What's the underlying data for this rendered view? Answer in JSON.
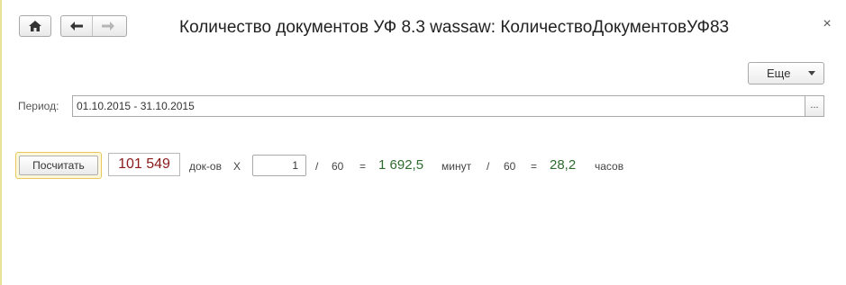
{
  "window": {
    "title": "Количество документов УФ 8.3 wassaw: КоличествоДокументовУФ83",
    "close_glyph": "×"
  },
  "nav": {
    "home_icon": "home-icon",
    "back_icon": "arrow-left-icon",
    "forward_icon": "arrow-right-icon"
  },
  "toolbar": {
    "more_label": "Еще"
  },
  "period": {
    "label": "Период:",
    "value": "01.10.2015 - 31.10.2015",
    "select_label": "..."
  },
  "calc": {
    "button_label": "Посчитать",
    "doc_count": "101 549",
    "doc_unit": "док-ов",
    "times": "X",
    "multiplier": "1",
    "div1": "/",
    "sixty1": "60",
    "eq1": "=",
    "minutes_value": "1 692,5",
    "minutes_unit": "минут",
    "div2": "/",
    "sixty2": "60",
    "eq2": "=",
    "hours_value": "28,2",
    "hours_unit": "часов"
  },
  "colors": {
    "count": "#8b1a1a",
    "result": "#2e6b2e",
    "accent_border": "#e8c85a"
  }
}
